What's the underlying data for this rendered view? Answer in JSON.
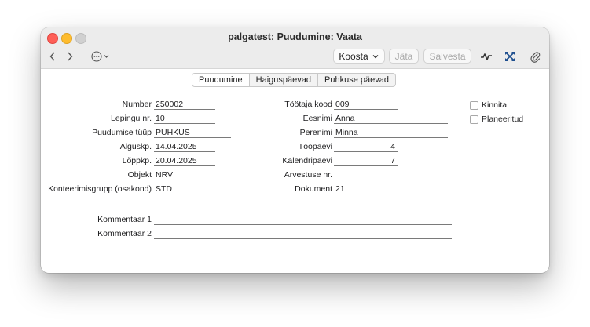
{
  "window": {
    "title": "palgatest: Puudumine: Vaata"
  },
  "toolbar": {
    "back_icon": "chevron-left-icon",
    "forward_icon": "chevron-right-icon",
    "more_icon": "ellipsis-circle-icon",
    "koosta_label": "Koosta",
    "jata_label": "Jäta",
    "salvesta_label": "Salvesta",
    "activity_icon": "activity-icon",
    "expand_icon": "expand-icon",
    "attach_icon": "paperclip-icon"
  },
  "tabs": [
    {
      "label": "Puudumine",
      "active": true
    },
    {
      "label": "Haiguspäevad",
      "active": false
    },
    {
      "label": "Puhkuse päevad",
      "active": false
    }
  ],
  "left_fields": [
    {
      "label": "Number",
      "value": "250002"
    },
    {
      "label": "Lepingu nr.",
      "value": "10"
    },
    {
      "label": "Puudumise tüüp",
      "value": "PUHKUS"
    },
    {
      "label": "Alguskp.",
      "value": "14.04.2025"
    },
    {
      "label": "Lõppkp.",
      "value": "20.04.2025"
    },
    {
      "label": "Objekt",
      "value": "NRV"
    },
    {
      "label": "Konteerimisgrupp (osakond)",
      "value": "STD"
    }
  ],
  "mid_fields": [
    {
      "label": "Töötaja kood",
      "value": "009"
    },
    {
      "label": "Eesnimi",
      "value": "Anna"
    },
    {
      "label": "Perenimi",
      "value": "Minna"
    },
    {
      "label": "Tööpäevi",
      "value": "4"
    },
    {
      "label": "Kalendripäevi",
      "value": "7"
    },
    {
      "label": "Arvestuse nr.",
      "value": ""
    },
    {
      "label": "Dokument",
      "value": "21"
    }
  ],
  "checkboxes": [
    {
      "label": "Kinnita",
      "checked": false
    },
    {
      "label": "Planeeritud",
      "checked": false
    }
  ],
  "comments": [
    {
      "label": "Kommentaar 1",
      "value": ""
    },
    {
      "label": "Kommentaar 2",
      "value": ""
    }
  ]
}
